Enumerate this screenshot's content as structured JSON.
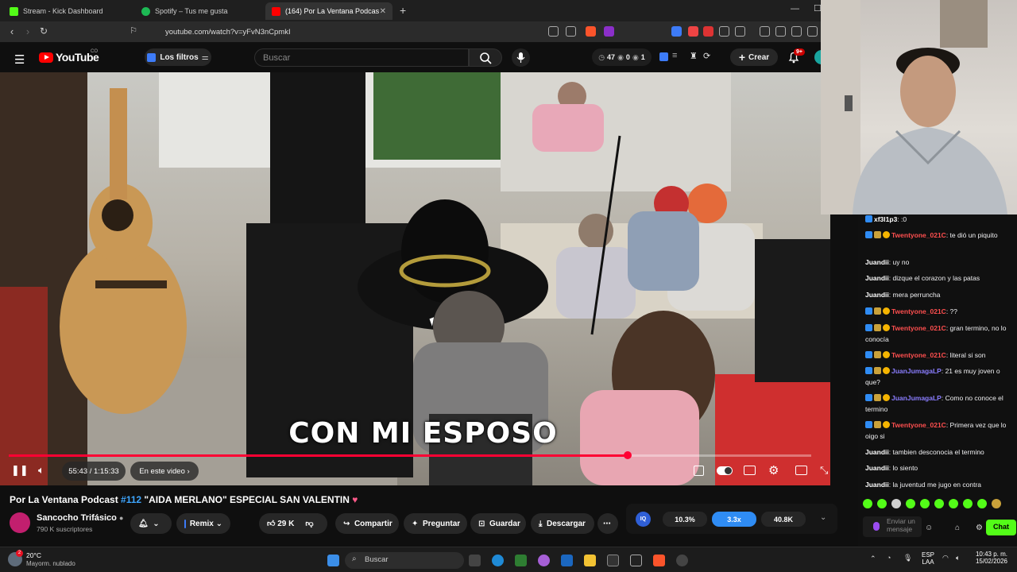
{
  "browser": {
    "tabs": [
      {
        "label": "Stream - Kick Dashboard",
        "color": "#53fc18"
      },
      {
        "label": "Spotify – Tus me gusta",
        "color": "#1db954"
      },
      {
        "label": "(164) Por La Ventana Podcast",
        "color": "#ff0000"
      }
    ],
    "url": "youtube.com/watch?v=yFvN3nCpmkI"
  },
  "youtube": {
    "logo_text": "YouTube",
    "country": "CO",
    "filters_label": "Los filtros",
    "search_placeholder": "Buscar",
    "counters": {
      "a": "47",
      "b": "0",
      "c": "1"
    },
    "create_label": "Crear",
    "notif_badge": "9+"
  },
  "player": {
    "subtitle": "CON MI ESPOSO",
    "time": "55:43 / 1:15:33",
    "chapter": "En este video",
    "progress": 0.7708
  },
  "video_info": {
    "title_prefix": "Por La Ventana Podcast ",
    "title_hash": "#112",
    "title_rest": " \"AIDA MERLANO\" ESPECIAL SAN VALENTIN",
    "channel": "Sancocho Trifásico",
    "subscribers": "790 K suscriptores",
    "remix": "Remix",
    "likes": "29 K",
    "share": "Compartir",
    "ask": "Preguntar",
    "save": "Guardar",
    "download": "Descargar"
  },
  "stats": {
    "left": "10.3%",
    "mid": "3.3x",
    "right": "40.8K"
  },
  "chat": {
    "messages": [
      {
        "user": "xf3l1p3",
        "text": ":0",
        "color": "#ffffff",
        "badges": 1
      },
      {
        "user": "Twentyone_021C",
        "text": "te dió un piquito",
        "color": "#ff4f4f",
        "badges": 3
      },
      {
        "user": "Juandii",
        "text": "uy no",
        "color": "#ffffff",
        "badges": 0
      },
      {
        "user": "Juandii",
        "text": "dizque el corazon y las patas",
        "color": "#ffffff",
        "badges": 0
      },
      {
        "user": "Juandii",
        "text": "mera perruncha",
        "color": "#ffffff",
        "badges": 0
      },
      {
        "user": "Twentyone_021C",
        "text": "??",
        "color": "#ff4f4f",
        "badges": 3
      },
      {
        "user": "Twentyone_021C",
        "text": "gran termino, no lo conocía",
        "color": "#ff4f4f",
        "badges": 3
      },
      {
        "user": "Twentyone_021C",
        "text": "literal si son",
        "color": "#ff4f4f",
        "badges": 3
      },
      {
        "user": "JuanJumagaLP",
        "text": "21 es muy joven o que?",
        "color": "#8a7dff",
        "badges": 3
      },
      {
        "user": "JuanJumagaLP",
        "text": "Como no conoce el termino",
        "color": "#8a7dff",
        "badges": 3
      },
      {
        "user": "Twentyone_021C",
        "text": "Primera vez que lo oigo si",
        "color": "#ff4f4f",
        "badges": 3
      },
      {
        "user": "Juandii",
        "text": "tambien desconocia el termino",
        "color": "#ffffff",
        "badges": 0
      },
      {
        "user": "Juandii",
        "text": "lo siento",
        "color": "#ffffff",
        "badges": 0
      },
      {
        "user": "Juandii",
        "text": "la juventud me jugo en contra",
        "color": "#ffffff",
        "badges": 0
      }
    ],
    "input_placeholder": "Enviar un mensaje",
    "send_label": "Chat"
  },
  "taskbar": {
    "weather_temp": "20°C",
    "weather_desc": "Mayorm. nublado",
    "search": "Buscar",
    "lang": "ESP",
    "lang2": "LAA",
    "time": "10:43 p. m.",
    "date": "15/02/2026",
    "weather_badge": "2"
  },
  "colors": {
    "accent": "#ff0033",
    "link": "#3ea6ff",
    "kick": "#53fc18"
  }
}
